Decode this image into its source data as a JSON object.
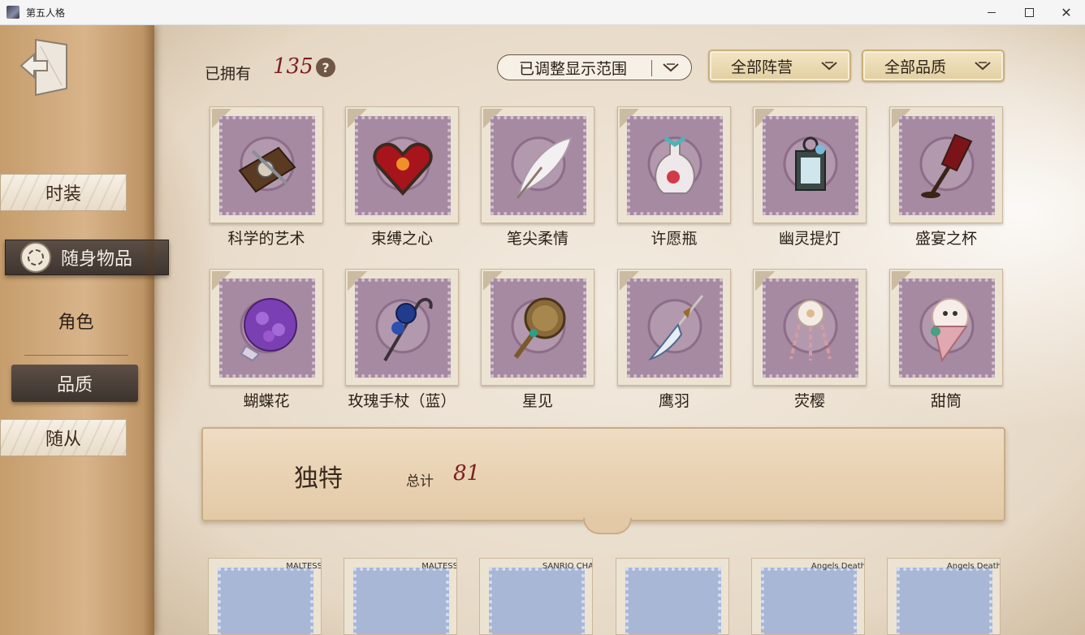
{
  "window": {
    "title": "第五人格",
    "min_label": "—",
    "max_label": "□",
    "close_label": "✕"
  },
  "sidebar": {
    "tabs": [
      "时装",
      "随身物品",
      "角色",
      "品质",
      "随从"
    ],
    "active_tab": "随身物品",
    "active_sub": "品质"
  },
  "header": {
    "owned_label": "已拥有",
    "owned_count": "135",
    "help": "?",
    "range_dropdown": "已调整显示范围",
    "camp_dropdown": "全部阵营",
    "quality_dropdown": "全部品质"
  },
  "items": [
    {
      "name": "科学的艺术",
      "icon": "science-art-icon"
    },
    {
      "name": "束缚之心",
      "icon": "bound-heart-icon"
    },
    {
      "name": "笔尖柔情",
      "icon": "quill-pen-icon"
    },
    {
      "name": "许愿瓶",
      "icon": "wishing-bottle-icon"
    },
    {
      "name": "幽灵提灯",
      "icon": "ghost-lantern-icon"
    },
    {
      "name": "盛宴之杯",
      "icon": "feast-goblet-icon"
    },
    {
      "name": "蝴蝶花",
      "icon": "butterfly-flower-icon"
    },
    {
      "name": "玫瑰手杖（蓝）",
      "icon": "rose-cane-icon"
    },
    {
      "name": "星见",
      "icon": "star-mirror-icon"
    },
    {
      "name": "鹰羽",
      "icon": "eagle-feather-icon"
    },
    {
      "name": "荧樱",
      "icon": "glow-sakura-icon"
    },
    {
      "name": "甜筒",
      "icon": "ice-cream-cone-icon"
    }
  ],
  "banner": {
    "title": "独特",
    "total_label": "总计",
    "total": "81"
  },
  "bottom_row_tags": [
    "MALTESS",
    "MALTESS",
    "SANRIO CHA",
    "",
    "Angels Death",
    "Angels Death"
  ],
  "colors": {
    "accent_red": "#7c2023",
    "stamp_purple": "#a68aa2",
    "dark_tab": "#3f3530"
  }
}
